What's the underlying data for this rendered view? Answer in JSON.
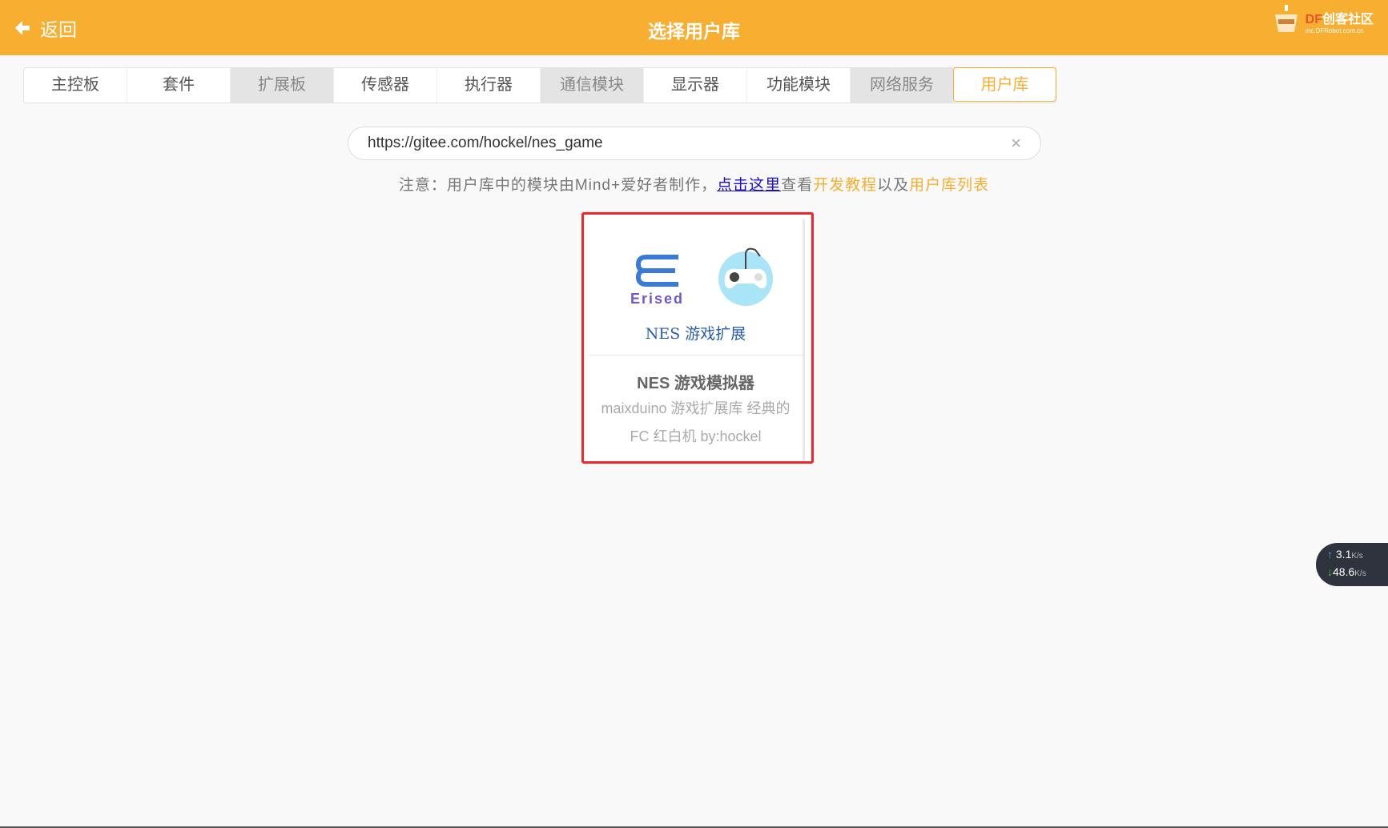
{
  "header": {
    "back_label": "返回",
    "title": "选择用户库",
    "logo_df": "DF",
    "logo_text": "创客社区",
    "logo_url": "mc.DFRobot.com.cn"
  },
  "tabs": [
    "主控板",
    "套件",
    "扩展板",
    "传感器",
    "执行器",
    "通信模块",
    "显示器",
    "功能模块",
    "网络服务",
    "用户库"
  ],
  "search": {
    "value": "https://gitee.com/hockel/nes_game",
    "clear": "×"
  },
  "note": {
    "prefix": "注意：用户库中的模块由Mind+爱好者制作，",
    "link": "点击这里",
    "mid1": "查看",
    "tutorial": "开发教程",
    "mid2": "以及",
    "list": "用户库列表"
  },
  "card": {
    "logo_text": "Erised",
    "image_caption": "NES 游戏扩展",
    "name": "NES 游戏模拟器",
    "description": "maixduino 游戏扩展库 经典的 FC 红白机 by:hockel"
  },
  "netspeed": {
    "up": "3.1",
    "down": "48.6",
    "unit": "K/s"
  }
}
